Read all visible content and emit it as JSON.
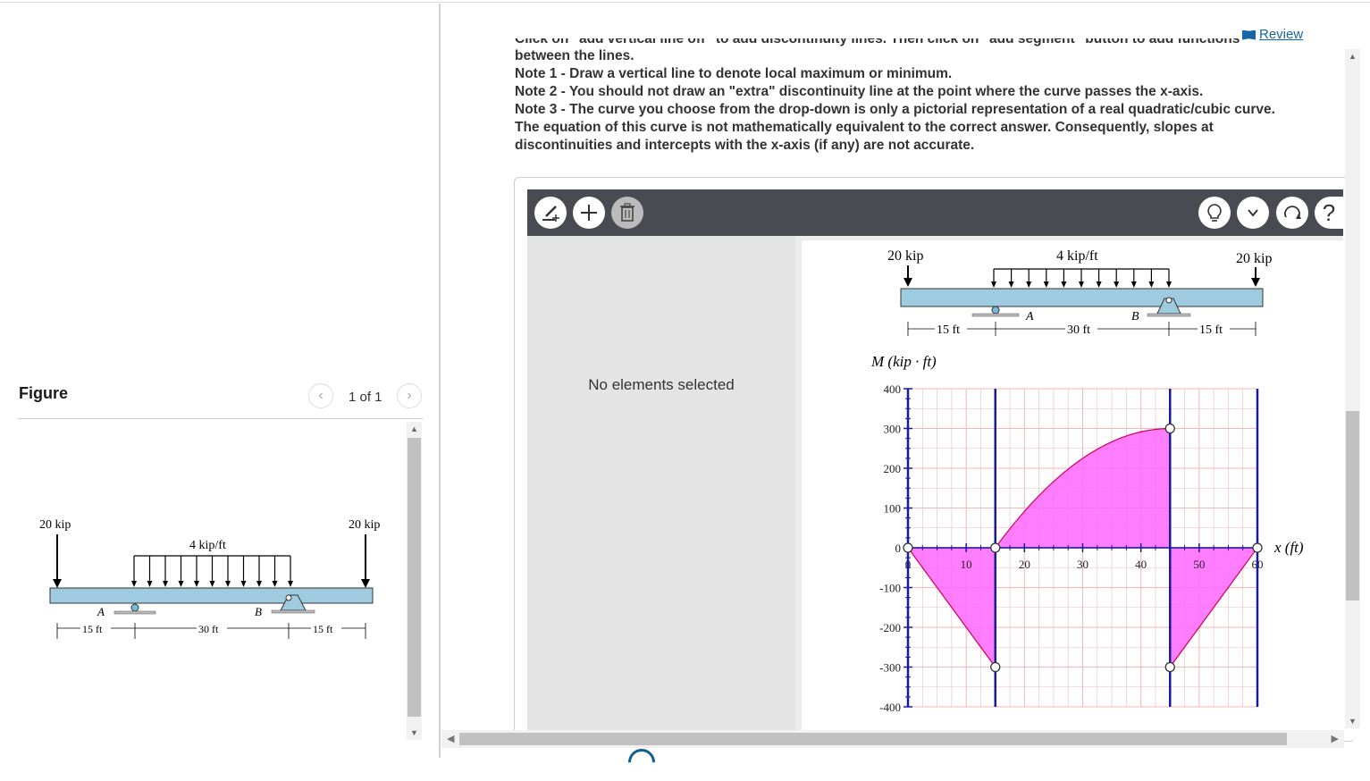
{
  "figure": {
    "title": "Figure",
    "counter": "1 of 1",
    "prev_icon": "chevron-left-icon",
    "next_icon": "chevron-right-icon"
  },
  "review": {
    "label": "Review",
    "icon": "book-icon"
  },
  "instructions": {
    "line0": "Click on \"add vertical line off\" to add discontinuity lines. Then click on \"add segment\" button to add functions",
    "line1": "between the lines.",
    "note1": "Note 1 - Draw a vertical line to denote local maximum or minimum.",
    "note2": "Note 2 - You should not draw an \"extra\" discontinuity line at the point where the curve passes the x-axis.",
    "note3a": "Note 3 - The curve you choose from the drop-down is only a pictorial representation of a real quadratic/cubic curve.",
    "note3b": "The equation of this curve is not mathematically equivalent to the correct answer. Consequently, slopes at",
    "note3c": "discontinuities and intercepts with the x-axis (if any) are not accurate."
  },
  "toolbar": {
    "left_tools": [
      "draw-vertical-line-icon",
      "add-segment-icon",
      "trash-icon"
    ],
    "right_tools": [
      "hint-lightbulb-icon",
      "chevron-down-icon",
      "reset-icon",
      "help-icon"
    ],
    "help_label": "?"
  },
  "side_panel": {
    "message": "No elements selected"
  },
  "beam": {
    "load_left": "20 kip",
    "load_right": "20 kip",
    "dist_load": "4 kip/ft",
    "support_a": "A",
    "support_b": "B",
    "span_left": "15 ft",
    "span_mid": "30 ft",
    "span_right": "15 ft"
  },
  "chart_data": {
    "type": "line",
    "ylabel": "M (kip · ft)",
    "xlabel": "x (ft)",
    "xlim": [
      0,
      60
    ],
    "ylim": [
      -400,
      400
    ],
    "x_ticks": [
      0,
      10,
      20,
      30,
      40,
      50,
      60
    ],
    "y_ticks": [
      400,
      300,
      200,
      100,
      0,
      -100,
      -200,
      -300,
      -400
    ],
    "grid": true,
    "discontinuity_lines_x": [
      0,
      15,
      45,
      60
    ],
    "segments": [
      {
        "shape": "linear",
        "points": [
          [
            0,
            0
          ],
          [
            15,
            -300
          ]
        ]
      },
      {
        "shape": "quadratic",
        "points": [
          [
            15,
            0
          ],
          [
            45,
            300
          ]
        ]
      },
      {
        "shape": "linear",
        "points": [
          [
            45,
            -300
          ],
          [
            60,
            0
          ]
        ]
      }
    ],
    "colors": {
      "fill": "#ff66ff",
      "line": "#d4004a",
      "discontinuity": "#1a1aa0",
      "grid": "#f4b6b6"
    }
  }
}
